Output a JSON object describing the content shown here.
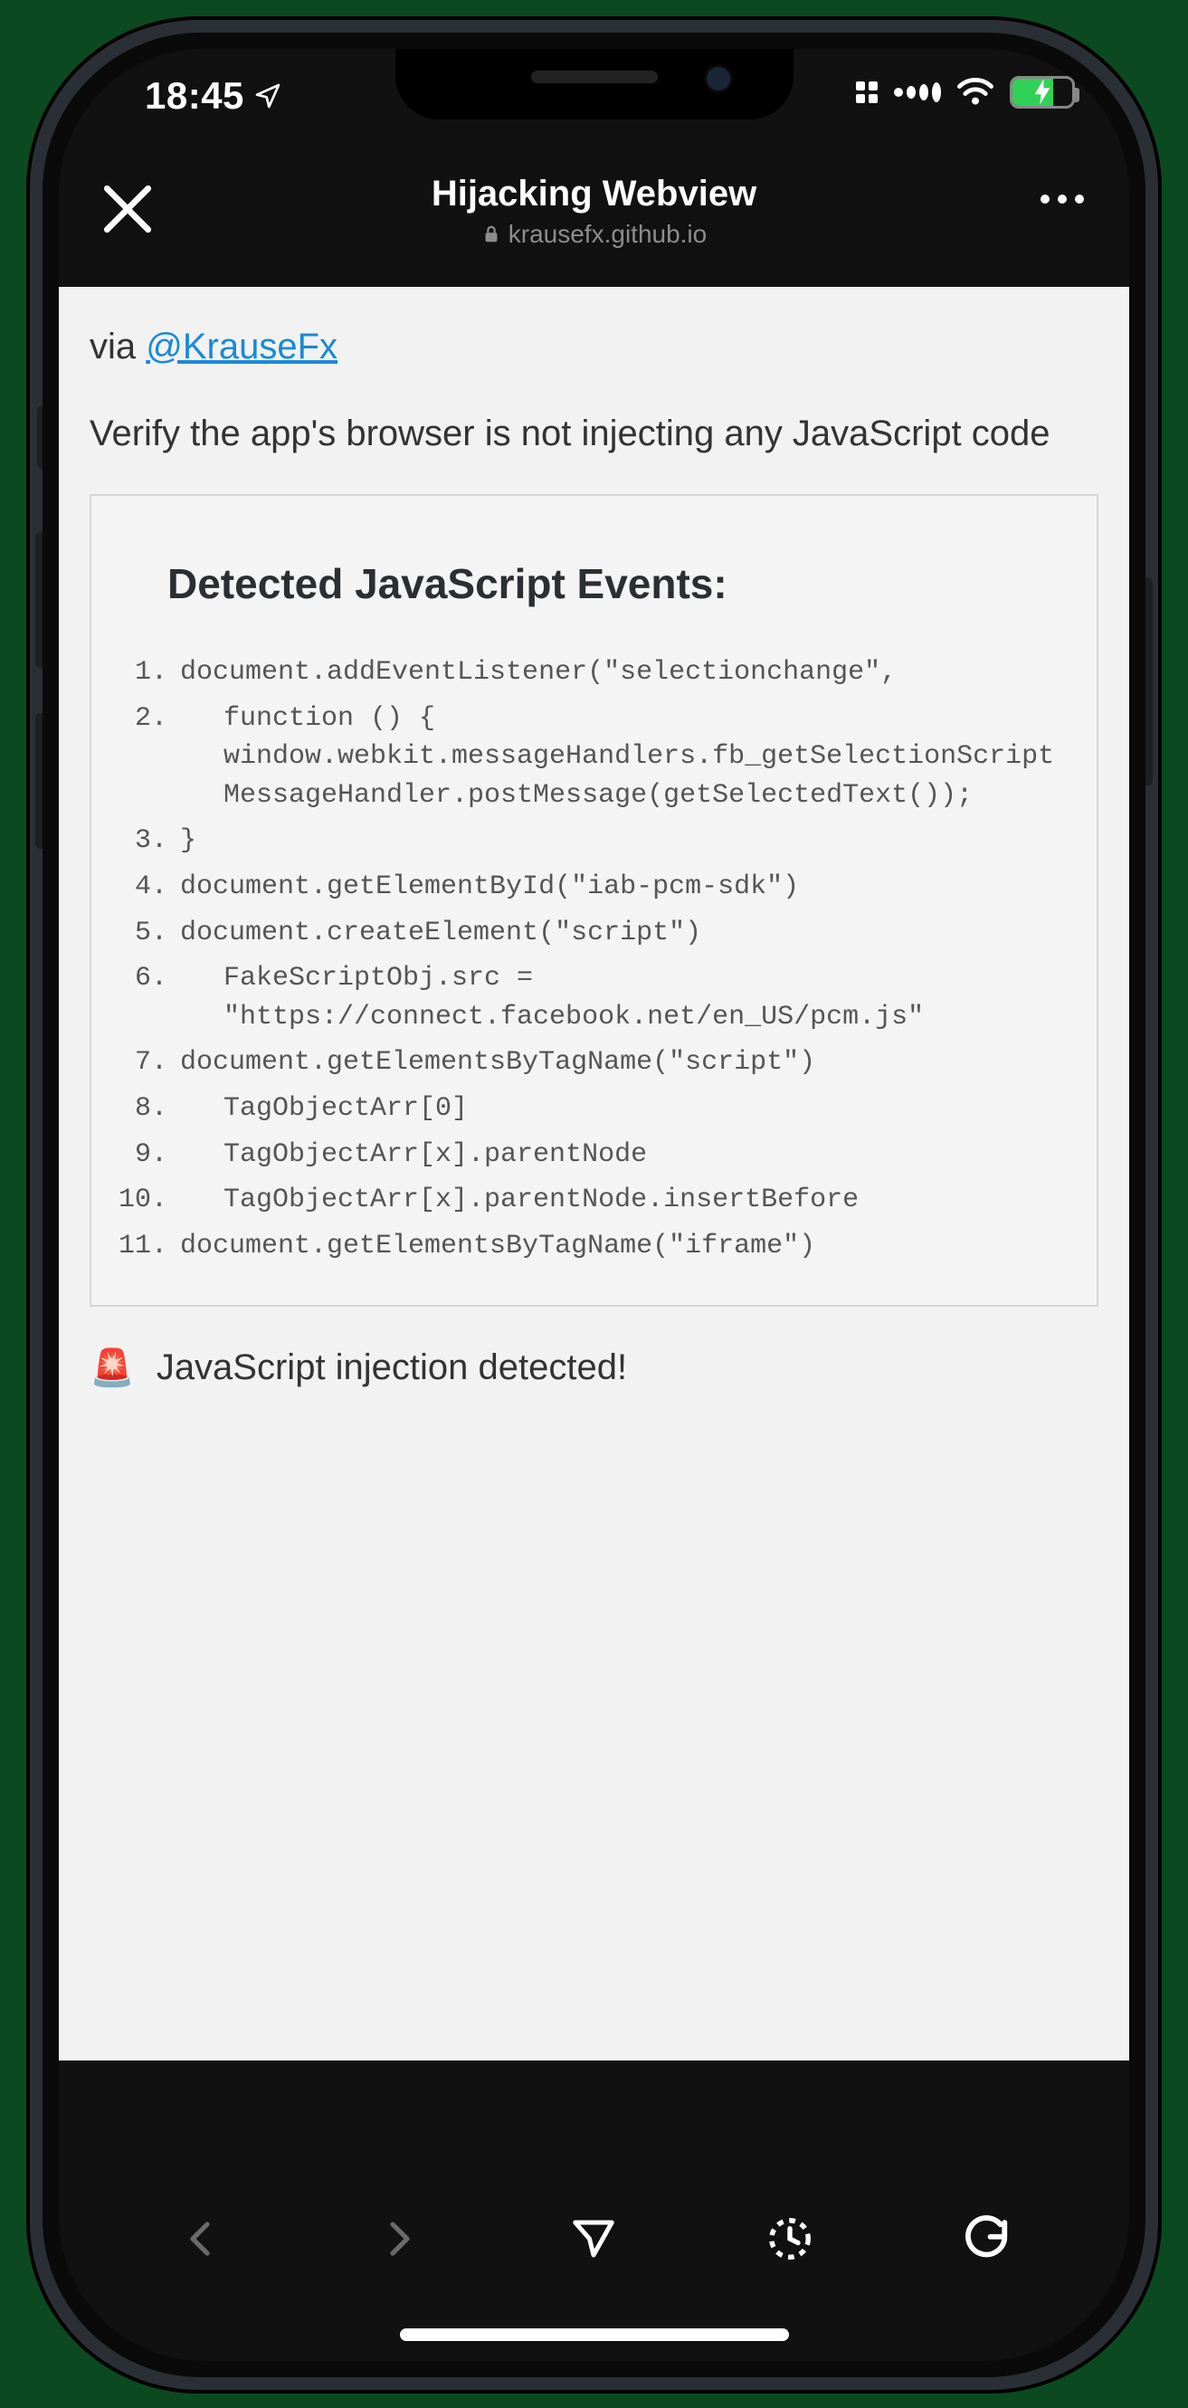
{
  "statusbar": {
    "time": "18:45"
  },
  "header": {
    "title": "Hijacking Webview",
    "domain": "krausefx.github.io"
  },
  "page": {
    "via_prefix": "via ",
    "via_handle": "@KrauseFx",
    "lead": "Verify the app's browser is not injecting any JavaScript code",
    "events_title": "Detected JavaScript Events:",
    "events": [
      {
        "n": "1.",
        "code": "document.addEventListener(\"selectionchange\",",
        "indent": 0
      },
      {
        "n": "2.",
        "code": "function () { window.webkit.messageHandlers.fb_getSelectionScriptMessageHandler.postMessage(getSelectedText());",
        "indent": 1
      },
      {
        "n": "3.",
        "code": "}",
        "indent": 0
      },
      {
        "n": "4.",
        "code": "document.getElementById(\"iab-pcm-sdk\")",
        "indent": 0
      },
      {
        "n": "5.",
        "code": "document.createElement(\"script\")",
        "indent": 0
      },
      {
        "n": "6.",
        "code": "FakeScriptObj.src = \"https://connect.facebook.net/en_US/pcm.js\"",
        "indent": 1
      },
      {
        "n": "7.",
        "code": "document.getElementsByTagName(\"script\")",
        "indent": 0
      },
      {
        "n": "8.",
        "code": "TagObjectArr[0]",
        "indent": 1
      },
      {
        "n": "9.",
        "code": "TagObjectArr[x].parentNode",
        "indent": 1
      },
      {
        "n": "10.",
        "code": "TagObjectArr[x].parentNode.insertBefore",
        "indent": 1
      },
      {
        "n": "11.",
        "code": "document.getElementsByTagName(\"iframe\")",
        "indent": 0
      }
    ],
    "alert_emoji": "🚨",
    "alert_text": "JavaScript injection detected!"
  }
}
